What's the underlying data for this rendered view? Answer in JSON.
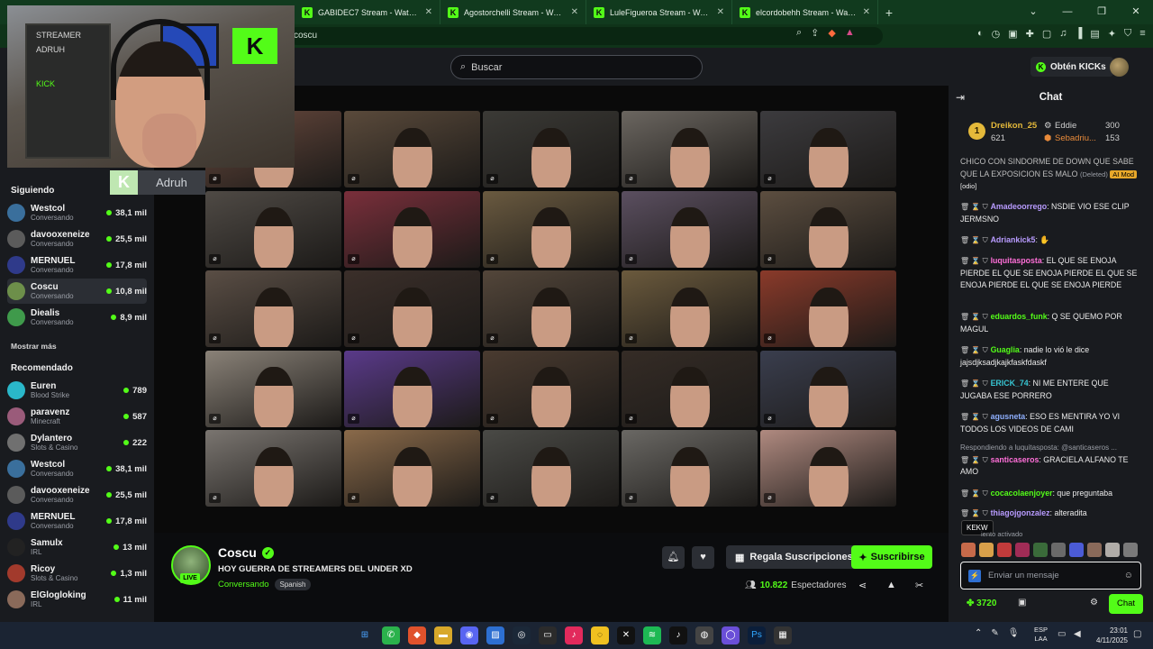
{
  "browser": {
    "tabs": [
      {
        "label": "GABIDEC7 Stream - Watch Live on Ki"
      },
      {
        "label": "Agostorchelli Stream - Watch Live on"
      },
      {
        "label": "LuleFigueroa Stream - Watch Live on"
      },
      {
        "label": "elcordobehh Stream - Watch Live on"
      }
    ],
    "new_tab": "+",
    "url": "coscu"
  },
  "header": {
    "search_placeholder": "Buscar",
    "get_kicks": "Obtén KICKs"
  },
  "webcam": {
    "overlay_name": "Adruh",
    "wall_labels": [
      "STREAMER",
      "ADRUH",
      "KICK"
    ]
  },
  "sidebar": {
    "following_title": "Siguiendo",
    "following": [
      {
        "name": "Westcol",
        "category": "Conversando",
        "viewers": "38,1 mil",
        "color": "#3a6f9c"
      },
      {
        "name": "davooxeneize",
        "category": "Conversando",
        "viewers": "25,5 mil",
        "color": "#5b5b5b"
      },
      {
        "name": "MERNUEL",
        "category": "Conversando",
        "viewers": "17,8 mil",
        "color": "#2f3a8a"
      },
      {
        "name": "Coscu",
        "category": "Conversando",
        "viewers": "10,8 mil",
        "color": "#6d8f4a"
      },
      {
        "name": "Diealis",
        "category": "Conversando",
        "viewers": "8,9 mil",
        "color": "#3f9a4b"
      }
    ],
    "show_more": "Mostrar más",
    "recommended_title": "Recomendado",
    "recommended": [
      {
        "name": "Euren",
        "category": "Blood Strike",
        "viewers": "789",
        "color": "#2ab7c9"
      },
      {
        "name": "paravenz",
        "category": "Minecraft",
        "viewers": "587",
        "color": "#9a5b7a"
      },
      {
        "name": "Dylantero",
        "category": "Slots & Casino",
        "viewers": "222",
        "color": "#707070"
      },
      {
        "name": "Westcol",
        "category": "Conversando",
        "viewers": "38,1 mil",
        "color": "#3a6f9c"
      },
      {
        "name": "davooxeneize",
        "category": "Conversando",
        "viewers": "25,5 mil",
        "color": "#5b5b5b"
      },
      {
        "name": "MERNUEL",
        "category": "Conversando",
        "viewers": "17,8 mil",
        "color": "#2f3a8a"
      },
      {
        "name": "Samulx",
        "category": "IRL",
        "viewers": "13 mil",
        "color": "#222222"
      },
      {
        "name": "Ricoy",
        "category": "Slots & Casino",
        "viewers": "1,3 mil",
        "color": "#a23a2c"
      },
      {
        "name": "ElGlogloking",
        "category": "IRL",
        "viewers": "11 mil",
        "color": "#8a6a5a"
      }
    ]
  },
  "stream": {
    "streamer": "Coscu",
    "live_badge": "LIVE",
    "title": "HOY GUERRA DE STREAMERS DEL UNDER XD",
    "category": "Conversando",
    "language": "Spanish",
    "gift_label": "Regala Suscripciones",
    "subscribe_label": "Suscribirse",
    "viewer_count": "10.822",
    "viewer_label": "Espectadores",
    "tile_colors": [
      "#6b4b3f",
      "#5a4a3b",
      "#3b3a36",
      "#6b6660",
      "#3c3b3e",
      "#4f4a45",
      "#7a2f3b",
      "#6a5a40",
      "#5b4f60",
      "#5c4e40",
      "#5a4e45",
      "#3b2f2a",
      "#53463a",
      "#6b5a3d",
      "#8a3a2a",
      "#8a8278",
      "#5a3a8a",
      "#4a3b30",
      "#352c26",
      "#3a3e4e",
      "#7a7570",
      "#8a6a4a",
      "#4a4a46",
      "#6a6864",
      "#b08a80"
    ]
  },
  "chat": {
    "title": "Chat",
    "leaderboard": {
      "rank": "1",
      "first_name": "Dreikon_25",
      "first_value": "621",
      "second_name": "Eddie",
      "second_value": "300",
      "third_name": "Sebadriu...",
      "third_value": "153"
    },
    "messages": [
      {
        "user": "",
        "color": "#eaeaea",
        "text": "CHICO CON SINDORME DE DOWN QUE SABE QUE LA EXPOSICION ES MALO",
        "deleted": "(Deleted)",
        "mod": "AI Mod",
        "tag": "[odio]"
      },
      {
        "user": "Amadeoorrego",
        "color": "#b89bff",
        "text": "NSDIE VIO ESE CLIP JERMSNO"
      },
      {
        "user": "Adriankick5",
        "color": "#b89bff",
        "text": ""
      },
      {
        "user": "luquitasposta",
        "color": "#ff6fd8",
        "text": "EL QUE SE ENOJA PIERDE EL QUE SE ENOJA PIERDE EL QUE SE ENOJA PIERDE EL QUE SE ENOJA PIERDE"
      },
      {
        "user": "eduardos_funk",
        "color": "#53fc18",
        "text": "Q SE QUEMO POR MAGUL"
      },
      {
        "user": "Guaglia",
        "color": "#53fc18",
        "text": "nadie lo vió le dice jajsdjksadjkajkfaskfdaskf"
      },
      {
        "user": "ERICK_74",
        "color": "#37c6d3",
        "text": "NI ME ENTERE QUE JUGABA ESE PORRERO"
      },
      {
        "user": "agusneta",
        "color": "#8fb0ff",
        "text": "ESO ES MENTIRA YO VI TODOS LOS VIDEOS DE CAMI"
      },
      {
        "reply": "Respondiendo a luquitasposta: @santicaseros ...",
        "user": "santicaseros",
        "color": "#ff6fd8",
        "text": "GRACIELA ALFANO TE AMO"
      },
      {
        "user": "cocacolaenjoyer",
        "color": "#53fc18",
        "text": "que preguntaba"
      },
      {
        "user": "thiagojgonzalez",
        "color": "#b89bff",
        "text": "alteradita"
      }
    ],
    "tooltip": "KEKW",
    "mode_notice": "iento activado",
    "input_placeholder": "Enviar un mensaje",
    "kicks_balance": "3720",
    "send_label": "Chat"
  },
  "taskbar": {
    "lang_top": "ESP",
    "lang_bottom": "LAA",
    "time": "23:01",
    "date": "4/11/2025"
  }
}
